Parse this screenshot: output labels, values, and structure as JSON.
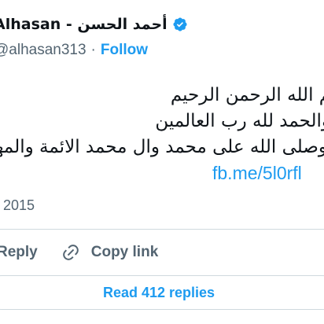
{
  "author": {
    "display_name": "Alhasan - أحمد الحسن",
    "handle": "@alhasan313",
    "separator": "·",
    "follow_label": "Follow",
    "verified_icon": "verified-badge-icon"
  },
  "tweet": {
    "lines": [
      "بسم الله الرحمن الرحيم",
      "والحمد لله رب العالمين",
      "وصلى الله على محمد وال محمد الائمة والمهديين"
    ],
    "link": "fb.me/5l0rfl",
    "date": "2015"
  },
  "actions": {
    "reply_label": "Reply",
    "reply_icon": "reply-icon",
    "copy_link_label": "Copy link",
    "copy_link_icon": "link-icon"
  },
  "read_replies_label": "Read 412 replies",
  "colors": {
    "accent": "#1d9bf0",
    "text": "#0f1419",
    "secondary": "#536471",
    "border": "#cfd9de"
  }
}
